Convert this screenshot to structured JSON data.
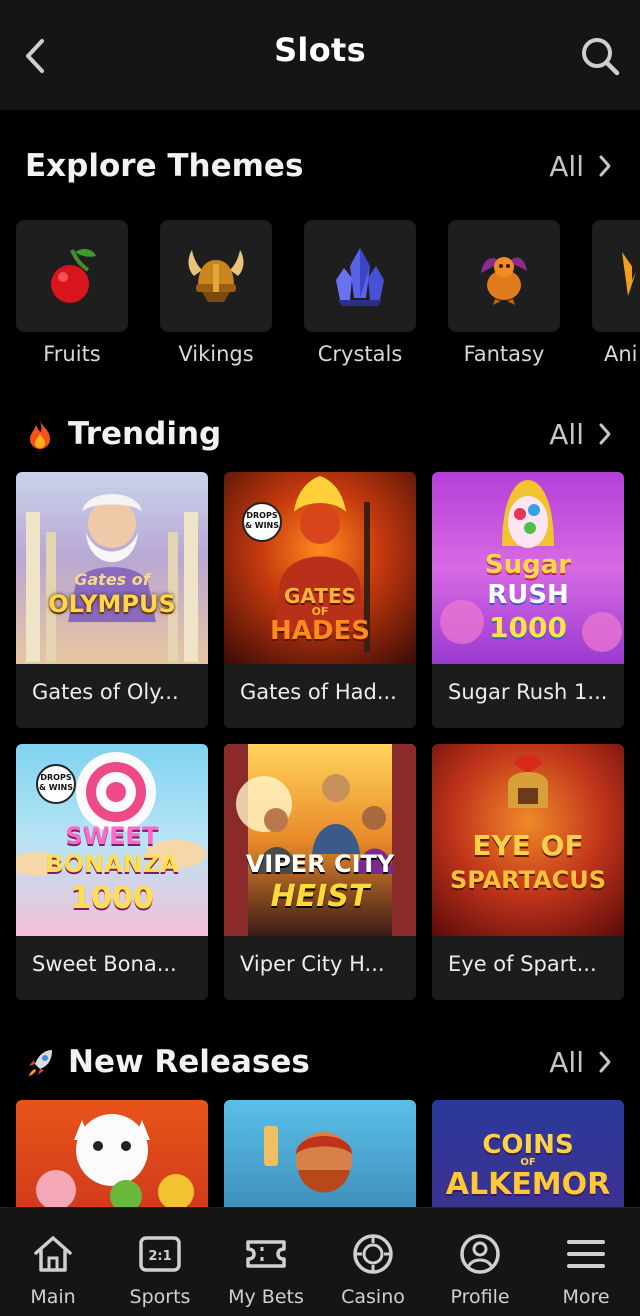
{
  "header": {
    "title": "Slots"
  },
  "themes": {
    "title": "Explore Themes",
    "all_label": "All",
    "items": [
      {
        "label": "Fruits",
        "icon": "cherry-icon"
      },
      {
        "label": "Vikings",
        "icon": "viking-helmet-icon"
      },
      {
        "label": "Crystals",
        "icon": "crystal-icon"
      },
      {
        "label": "Fantasy",
        "icon": "dragon-icon"
      },
      {
        "label": "Ani",
        "icon": "animal-icon"
      }
    ]
  },
  "trending": {
    "title": "Trending",
    "icon": "fire-icon",
    "all_label": "All",
    "games": [
      {
        "name": "Gates of Oly...",
        "art": [
          "Gates of",
          "OLYMPUS"
        ]
      },
      {
        "name": "Gates of Had...",
        "art": [
          "GATES",
          "OF",
          "HADES"
        ],
        "badge": [
          "DROPS",
          "& WINS"
        ]
      },
      {
        "name": "Sugar Rush 1...",
        "art": [
          "Sugar",
          "RUSH",
          "1000"
        ]
      },
      {
        "name": "Sweet Bona...",
        "art": [
          "SWEET",
          "BONANZA",
          "1000"
        ],
        "badge": [
          "DROPS",
          "& WINS"
        ]
      },
      {
        "name": "Viper City H...",
        "art": [
          "VIPER CITY",
          "HEIST"
        ]
      },
      {
        "name": "Eye of Spart...",
        "art": [
          "EYE OF",
          "SPARTACUS"
        ]
      }
    ]
  },
  "new_releases": {
    "title": "New Releases",
    "icon": "rocket-icon",
    "all_label": "All",
    "games": [
      {
        "art": []
      },
      {
        "art": []
      },
      {
        "art": [
          "COINS",
          "OF",
          "ALKEMOR"
        ]
      }
    ]
  },
  "bottom_nav": [
    {
      "label": "Main",
      "icon": "home-icon"
    },
    {
      "label": "Sports",
      "icon": "scoreboard-icon"
    },
    {
      "label": "My Bets",
      "icon": "ticket-icon"
    },
    {
      "label": "Casino",
      "icon": "casino-chip-icon"
    },
    {
      "label": "Profile",
      "icon": "profile-icon"
    },
    {
      "label": "More",
      "icon": "menu-icon"
    }
  ],
  "colors": {
    "background": "#000000",
    "bar": "#151515",
    "tile": "#1e1e1e",
    "card": "#1c1c1c",
    "muted_text": "#c6c6c6"
  }
}
